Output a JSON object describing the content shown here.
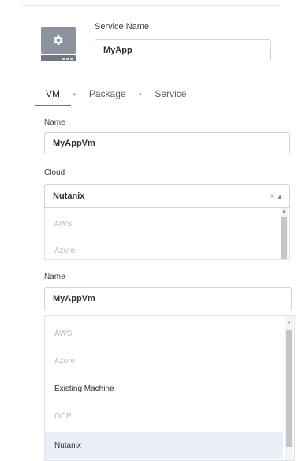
{
  "service": {
    "name_label": "Service Name",
    "name_value": "MyApp"
  },
  "tabs": [
    {
      "label": "VM",
      "active": true
    },
    {
      "label": "Package",
      "active": false
    },
    {
      "label": "Service",
      "active": false
    }
  ],
  "vm_form": {
    "name_label": "Name",
    "name_value": "MyAppVm",
    "cloud_label": "Cloud",
    "cloud_value": "Nutanix",
    "cloud_clear": "×",
    "cloud_arrow": "▲",
    "cloud_options_visible": [
      "AWS",
      "Azure"
    ]
  },
  "lower_form": {
    "name_label": "Name",
    "name_value": "MyAppVm",
    "options": [
      {
        "label": "AWS",
        "state": "disabled"
      },
      {
        "label": "Azure",
        "state": "disabled"
      },
      {
        "label": "Existing Machine",
        "state": "enabled"
      },
      {
        "label": "GCP",
        "state": "disabled"
      },
      {
        "label": "Nutanix",
        "state": "selected"
      }
    ]
  },
  "colors": {
    "tab_accent": "#2f7fd8",
    "selected_option_bg": "#e9eef7",
    "icon_gray": "#8a939e"
  },
  "icons": {
    "service": "gear-icon",
    "clear": "close-icon",
    "dropdown": "chevron-up-icon"
  }
}
